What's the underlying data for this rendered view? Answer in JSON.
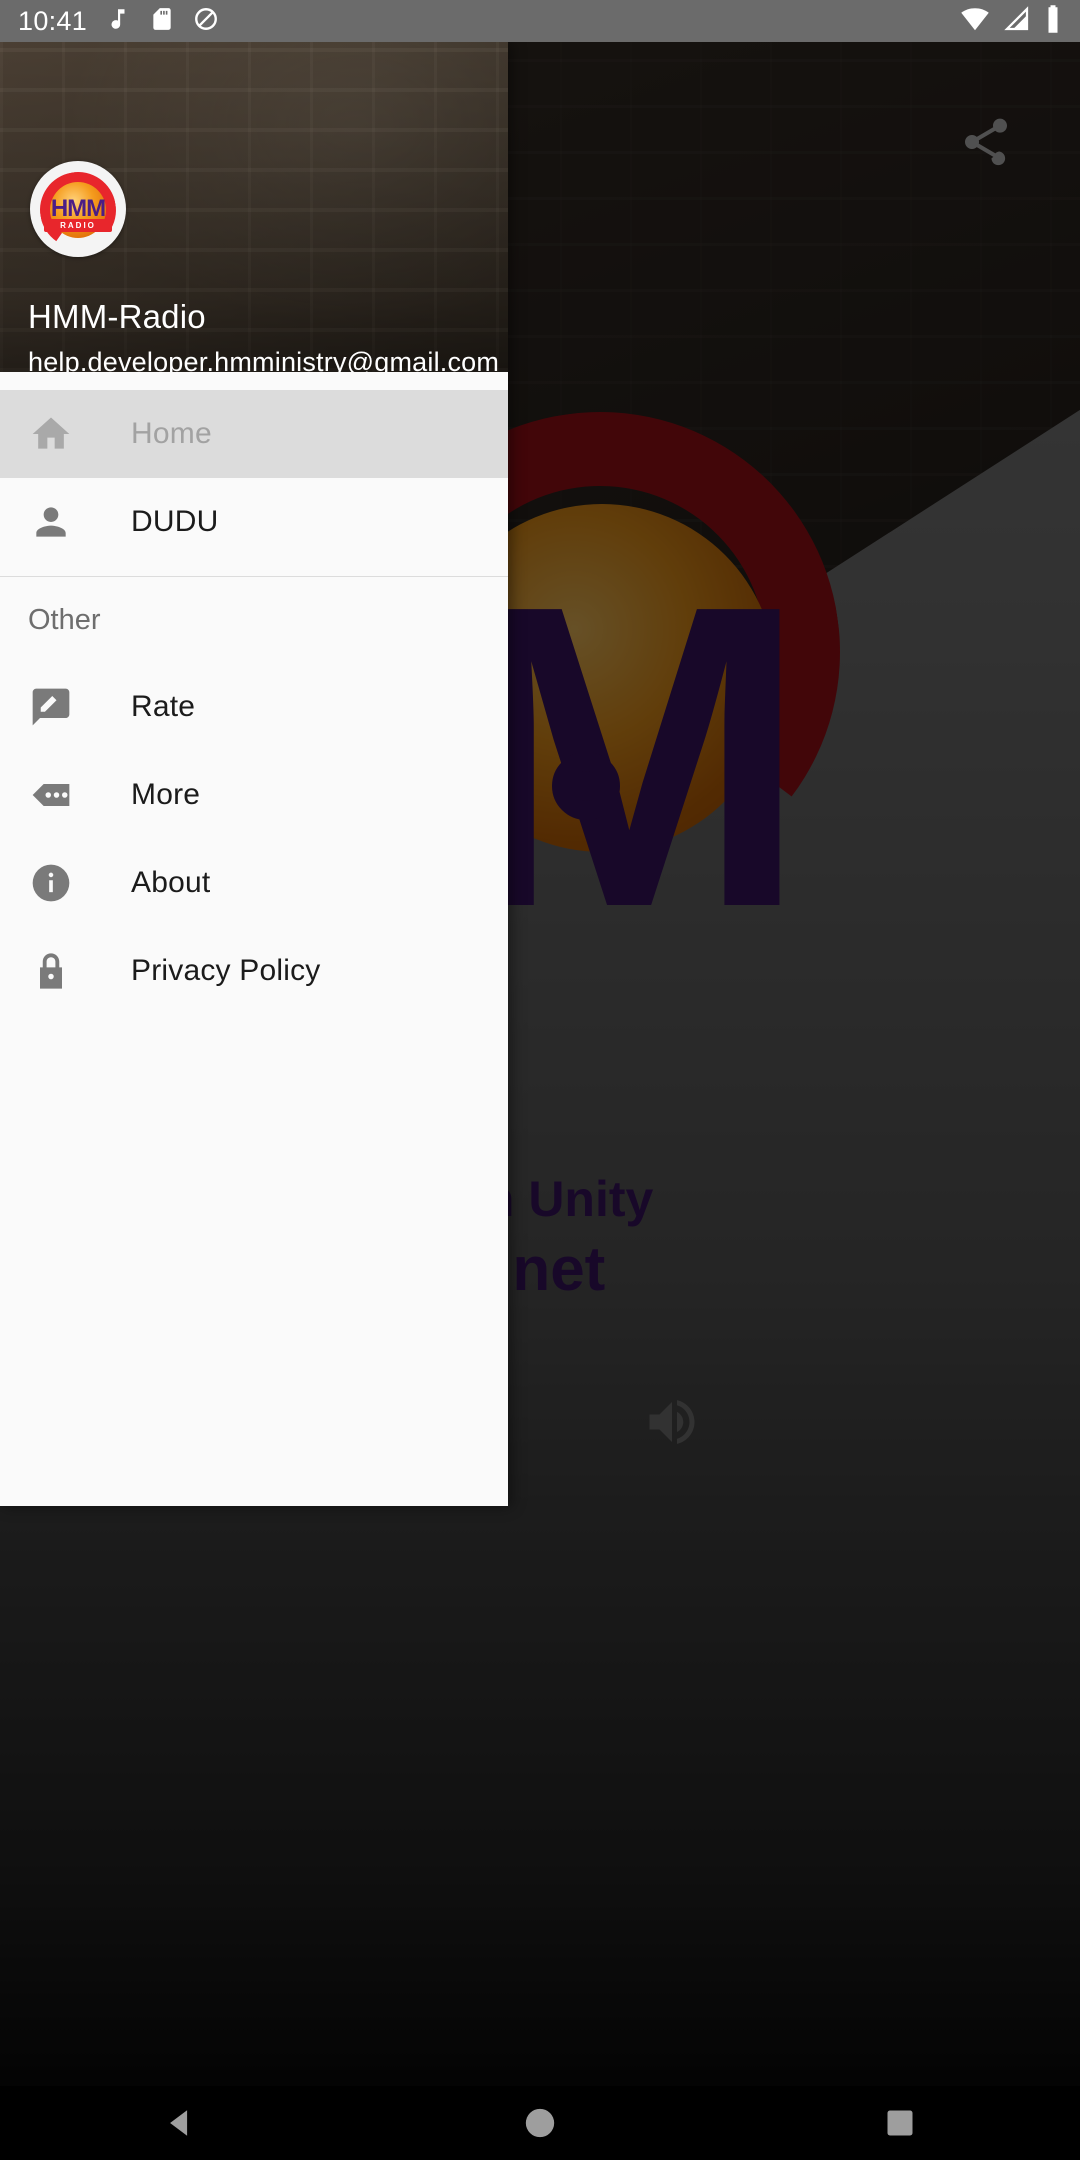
{
  "status_bar": {
    "time": "10:41",
    "left_icons": [
      "music-note-icon",
      "sd-card-icon",
      "do-not-disturb-icon"
    ],
    "right_icons": [
      "wifi-icon",
      "cellular-signal-icon",
      "battery-icon"
    ]
  },
  "drawer": {
    "account": {
      "name": "HMM-Radio",
      "email": "help.developer.hmministry@gmail.com",
      "avatar_text": "HMM",
      "avatar_subtext": "RADIO"
    },
    "items": [
      {
        "label": "Home",
        "icon": "home-icon",
        "selected": true
      },
      {
        "label": "DUDU",
        "icon": "person-icon",
        "selected": false
      }
    ],
    "section_title": "Other",
    "other_items": [
      {
        "label": "Rate",
        "icon": "rate-review-icon"
      },
      {
        "label": "More",
        "icon": "more-horiz-bubble-icon"
      },
      {
        "label": "About",
        "icon": "info-icon"
      },
      {
        "label": "Privacy Policy",
        "icon": "lock-icon"
      }
    ]
  },
  "background_app": {
    "share_icon": "share-icon",
    "volume_icon": "volume-up-icon",
    "logo_letter": "M",
    "tagline_line1": "in Unity",
    "tagline_line2": "io.net"
  },
  "nav_bar": {
    "back": "back-triangle-icon",
    "home": "home-circle-icon",
    "recents": "recents-square-icon"
  },
  "colors": {
    "status_bar_bg": "#6b6b6b",
    "drawer_bg": "#fafafa",
    "selected_row_bg": "#dcdcdc",
    "header_bg": "#443a2f",
    "logo_purple": "#3d1466",
    "logo_red": "#a51118",
    "logo_orange": "#f29a1b",
    "nav_bar_bg": "#000000"
  }
}
